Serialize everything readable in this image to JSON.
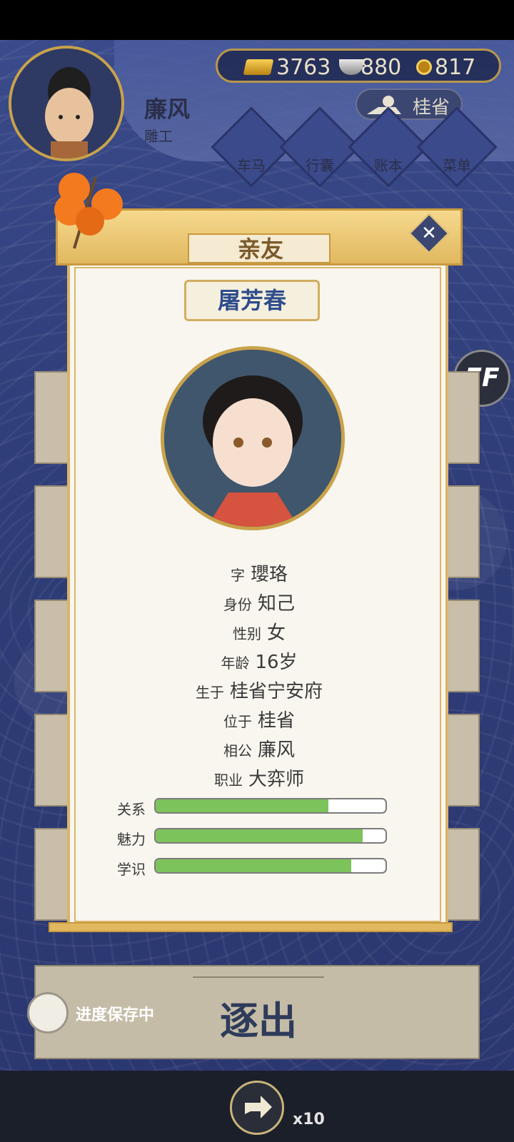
{
  "player": {
    "name": "廉风",
    "job": "雕工"
  },
  "currency": {
    "gold": "3763",
    "silver": "880",
    "coins": "817"
  },
  "location": {
    "label": "桂省"
  },
  "menu": [
    {
      "label": "车马",
      "icon": "carriage-icon"
    },
    {
      "label": "行囊",
      "icon": "bag-icon"
    },
    {
      "label": "账本",
      "icon": "ledger-icon"
    },
    {
      "label": "菜单",
      "icon": "more-icon"
    }
  ],
  "speed_badge": "FF",
  "modal": {
    "title": "亲友",
    "person_name": "屠芳春",
    "info": [
      {
        "key": "字",
        "value": "瓔珞"
      },
      {
        "key": "身份",
        "value": "知己"
      },
      {
        "key": "性别",
        "value": "女"
      },
      {
        "key": "年龄",
        "value": "16岁"
      },
      {
        "key": "生于",
        "value": "桂省宁安府"
      },
      {
        "key": "位于",
        "value": "桂省"
      },
      {
        "key": "相公",
        "value": "廉风"
      },
      {
        "key": "职业",
        "value": "大弈师"
      }
    ],
    "stats": [
      {
        "label": "关系",
        "value": 0.75
      },
      {
        "label": "魅力",
        "value": 0.9
      },
      {
        "label": "学识",
        "value": 0.85
      }
    ]
  },
  "chase_button": "逐出",
  "saving_text": "进度保存中",
  "share": {
    "count": "x10"
  }
}
